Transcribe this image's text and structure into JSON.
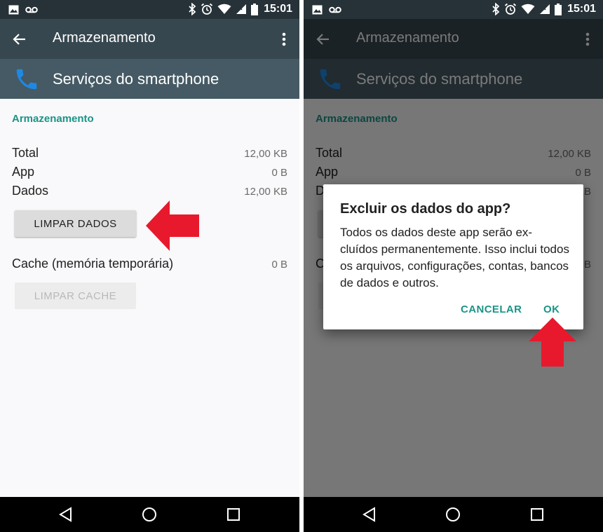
{
  "status_bar": {
    "time": "15:01"
  },
  "toolbar": {
    "title": "Armazenamento"
  },
  "app_header": {
    "name": "Serviços do smartphone"
  },
  "storage": {
    "section_title": "Armazenamento",
    "rows": [
      {
        "label": "Total",
        "value": "12,00 KB"
      },
      {
        "label": "App",
        "value": "0 B"
      },
      {
        "label": "Dados",
        "value": "12,00 KB"
      }
    ],
    "clear_data_label": "LIMPAR DADOS",
    "cache": {
      "label": "Cache (memória temporária)",
      "value": "0 B"
    },
    "clear_cache_label": "LIMPAR CACHE"
  },
  "dialog": {
    "title": "Excluir os dados do app?",
    "message": "Todos os dados deste app serão ex- cluídos permanentemente. Isso inclui todos os arquivos, configurações, contas, bancos de dados e outros.",
    "cancel_label": "CANCELAR",
    "ok_label": "OK"
  },
  "colors": {
    "accent": "#1a9486",
    "status_bar": "#263238",
    "toolbar": "#37474f",
    "app_header": "#455a64",
    "phone_icon": "#1e88e5",
    "annotation_arrow": "#e8192c"
  },
  "icons": {
    "status_left": [
      "image-icon",
      "voicemail-icon"
    ],
    "status_right": [
      "bluetooth-icon",
      "alarm-icon",
      "wifi-icon",
      "signal-icon",
      "battery-icon"
    ],
    "toolbar": [
      "back-arrow-icon",
      "overflow-menu-icon"
    ],
    "app": "phone-icon",
    "nav": [
      "nav-back-icon",
      "nav-home-icon",
      "nav-recent-icon"
    ],
    "annotations": [
      "red-arrow-left-icon",
      "red-arrow-up-icon"
    ]
  }
}
